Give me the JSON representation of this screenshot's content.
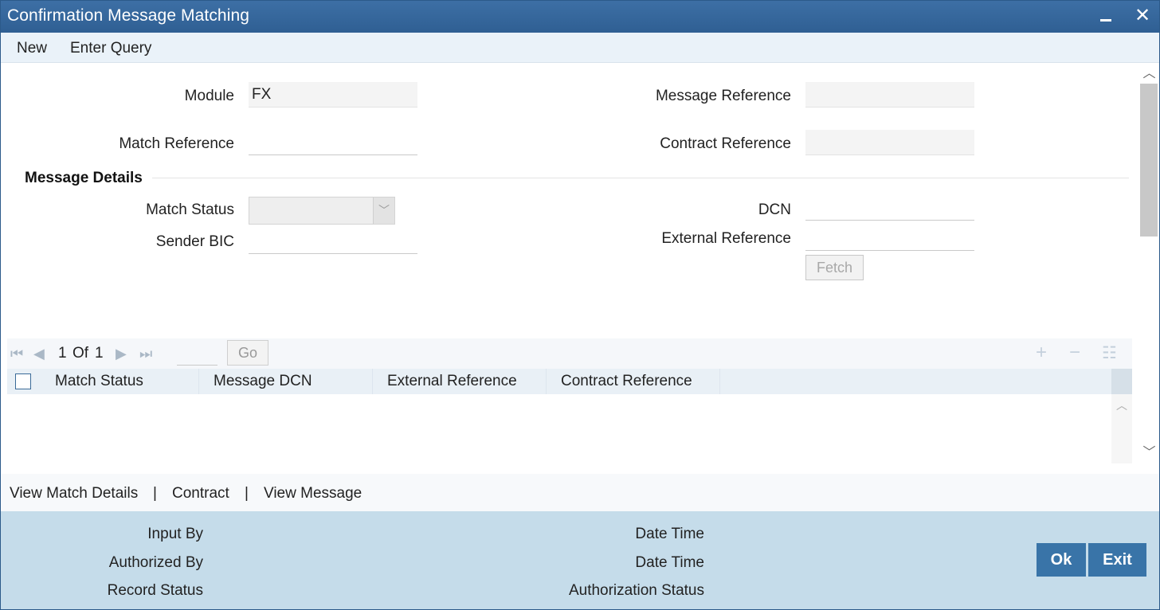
{
  "window": {
    "title": "Confirmation Message Matching"
  },
  "menu": {
    "new": "New",
    "enter_query": "Enter Query"
  },
  "form": {
    "module_label": "Module",
    "module_value": "FX",
    "message_reference_label": "Message Reference",
    "message_reference_value": "",
    "match_reference_label": "Match Reference",
    "match_reference_value": "",
    "contract_reference_label": "Contract Reference",
    "contract_reference_value": "",
    "section_title": "Message Details",
    "match_status_label": "Match Status",
    "match_status_value": "",
    "dcn_label": "DCN",
    "dcn_value": "",
    "sender_bic_label": "Sender BIC",
    "sender_bic_value": "",
    "external_reference_label": "External Reference",
    "external_reference_value": "",
    "fetch_label": "Fetch"
  },
  "grid": {
    "page_current": "1",
    "page_of": "Of",
    "page_total": "1",
    "go_label": "Go",
    "columns": [
      "Match Status",
      "Message DCN",
      "External Reference",
      "Contract Reference"
    ],
    "rows": []
  },
  "links": {
    "view_match_details": "View Match Details",
    "contract": "Contract",
    "view_message": "View Message",
    "separator": "|"
  },
  "footer": {
    "input_by": "Input By",
    "authorized_by": "Authorized By",
    "record_status": "Record Status",
    "date_time_1": "Date Time",
    "date_time_2": "Date Time",
    "authorization_status": "Authorization Status",
    "ok_label": "Ok",
    "exit_label": "Exit"
  },
  "colors": {
    "titlebar": "#2f5f93",
    "accent_button": "#3974a8",
    "footer_bg": "#c5dcea"
  }
}
